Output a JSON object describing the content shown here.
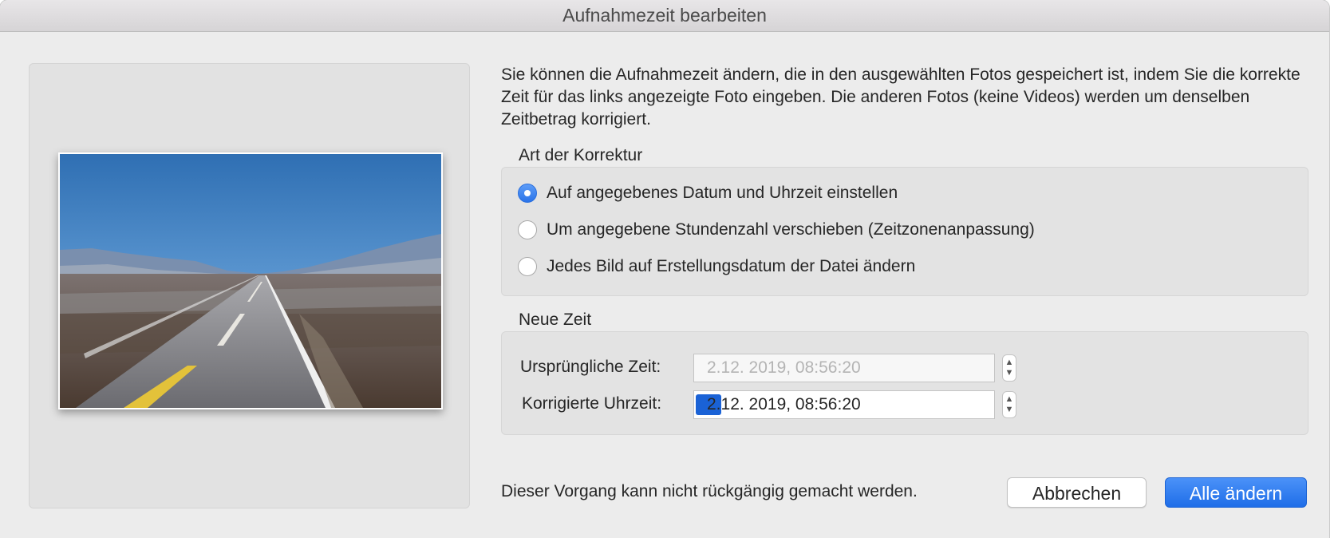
{
  "window": {
    "title": "Aufnahmezeit bearbeiten"
  },
  "description": "Sie können die Aufnahmezeit ändern, die in den ausgewählten Fotos gespeichert ist, indem Sie die korrekte Zeit für das links angezeigte Foto eingeben. Die anderen Fotos (keine Videos) werden um denselben Zeitbetrag korrigiert.",
  "correction": {
    "title": "Art der Korrektur",
    "options": [
      {
        "label": "Auf angegebenes Datum und Uhrzeit einstellen",
        "checked": true
      },
      {
        "label": "Um angegebene Stundenzahl verschieben (Zeitzonenanpassung)",
        "checked": false
      },
      {
        "label": "Jedes Bild auf Erstellungsdatum der Datei ändern",
        "checked": false
      }
    ]
  },
  "new_time": {
    "title": "Neue Zeit",
    "original_label": "Ursprüngliche Zeit:",
    "original_value": "2.12. 2019, 08:56:20",
    "corrected_label": "Korrigierte Uhrzeit:",
    "corrected_value": "2.12. 2019, 08:56:20"
  },
  "footer": {
    "note": "Dieser Vorgang kann nicht rückgängig gemacht werden.",
    "cancel_label": "Abbrechen",
    "confirm_label": "Alle ändern"
  },
  "icons": {
    "stepper_up": "▲",
    "stepper_down": "▼"
  },
  "colors": {
    "accent": "#2b74e9",
    "selection": "#1a62d6",
    "window_bg": "#ececec",
    "panel_bg": "#e3e3e3"
  }
}
